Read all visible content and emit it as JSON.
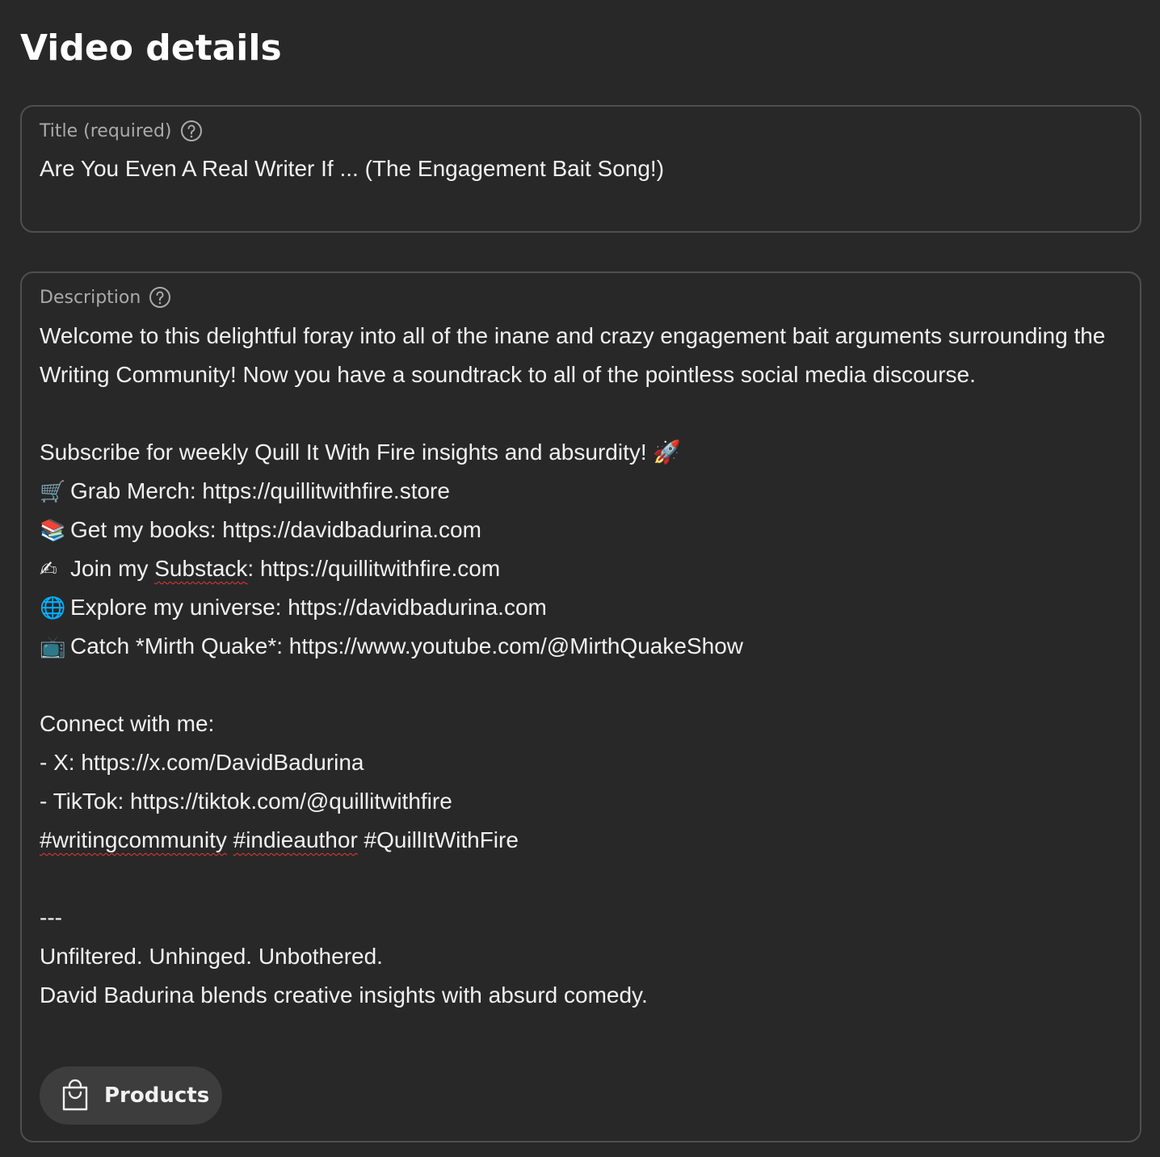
{
  "page": {
    "title": "Video details"
  },
  "title_field": {
    "label": "Title (required)",
    "help_icon": "help-circle-icon",
    "value": "Are You Even A Real Writer If ... (The Engagement Bait Song!)"
  },
  "description_field": {
    "label": "Description",
    "help_icon": "help-circle-icon",
    "intro": "Welcome to this delightful foray into all of the inane and crazy engagement bait arguments surrounding the Writing Community! Now you have a soundtrack to all of the pointless social media discourse.",
    "subscribe_text": "Subscribe for weekly Quill It With Fire insights and absurdity!",
    "subscribe_emoji": "🚀",
    "links": [
      {
        "emoji": "🛒",
        "icon": "shopping-cart-icon",
        "text": "Grab Merch: https://quillitwithfire.store"
      },
      {
        "emoji": "📚",
        "icon": "books-icon",
        "text": "Get my books: https://davidbadurina.com"
      },
      {
        "emoji": "✍",
        "icon": "writing-hand-icon",
        "pre": "Join my ",
        "flagged": "Substack",
        "post": ": https://quillitwithfire.com"
      },
      {
        "emoji": "🌐",
        "icon": "globe-icon",
        "text": "Explore my universe: https://davidbadurina.com"
      },
      {
        "emoji": "📺",
        "icon": "television-icon",
        "text": "Catch *Mirth Quake*: https://www.youtube.com/@MirthQuakeShow"
      }
    ],
    "connect_heading": "Connect with me:",
    "connect_x": "- X: https://x.com/DavidBadurina",
    "connect_tiktok": "- TikTok: https://tiktok.com/@quillitwithfire",
    "hashtags": {
      "tag1": "#writingcommunity",
      "tag2": "#indieauthor",
      "tag3": "#QuillItWithFire"
    },
    "separator": "---",
    "tagline": "Unfiltered. Unhinged. Unbothered.",
    "bio": "David Badurina blends creative insights with absurd comedy."
  },
  "products_button": {
    "label": "Products",
    "icon": "shopping-bag-icon"
  }
}
